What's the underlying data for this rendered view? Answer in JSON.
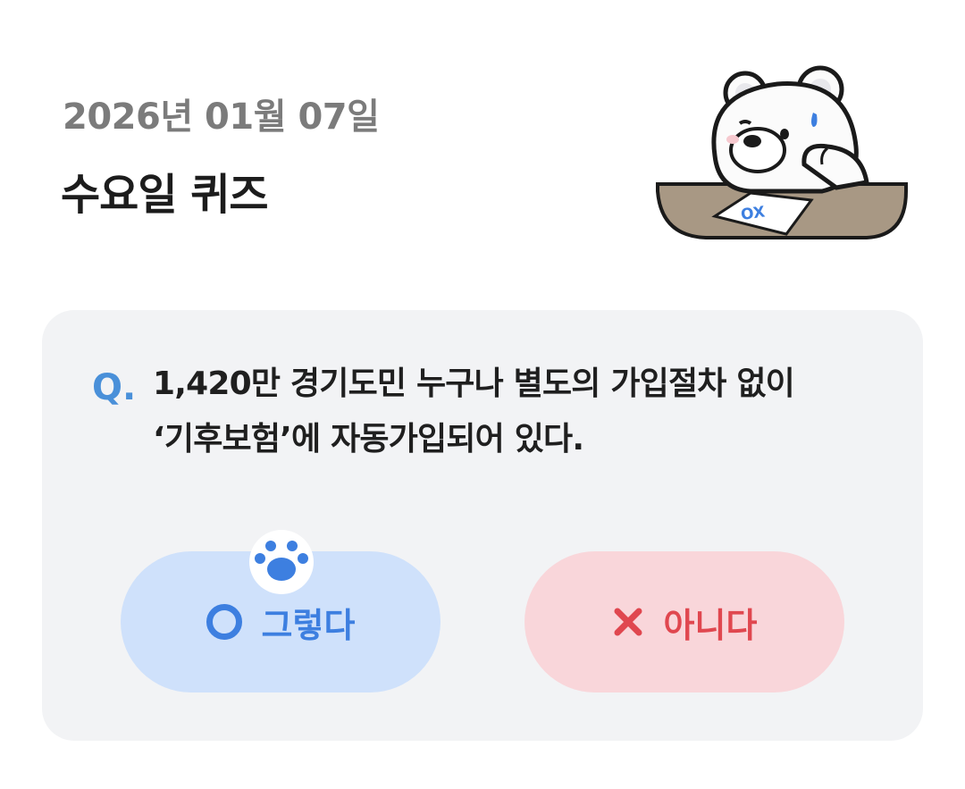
{
  "header": {
    "date": "2026년 01월 07일",
    "title": "수요일 퀴즈"
  },
  "quiz": {
    "q_marker": "Q.",
    "question_line1": "1,420만 경기도민 누구나 별도의 가입절차 없이",
    "question_line2": "‘기후보험’에 자동가입되어 있다.",
    "yes_label": "그렇다",
    "no_label": "아니다",
    "paper_mark": "OX"
  },
  "colors": {
    "accent_blue": "#3d7fe0",
    "accent_red": "#e0474f",
    "yes_bg": "#cfe1fb",
    "no_bg": "#f9d6da",
    "card_bg": "#f2f3f5"
  },
  "icons": {
    "mascot": "polar-bear-thinking-icon",
    "paw": "paw-icon",
    "yes": "circle-o-icon",
    "no": "x-mark-icon"
  }
}
